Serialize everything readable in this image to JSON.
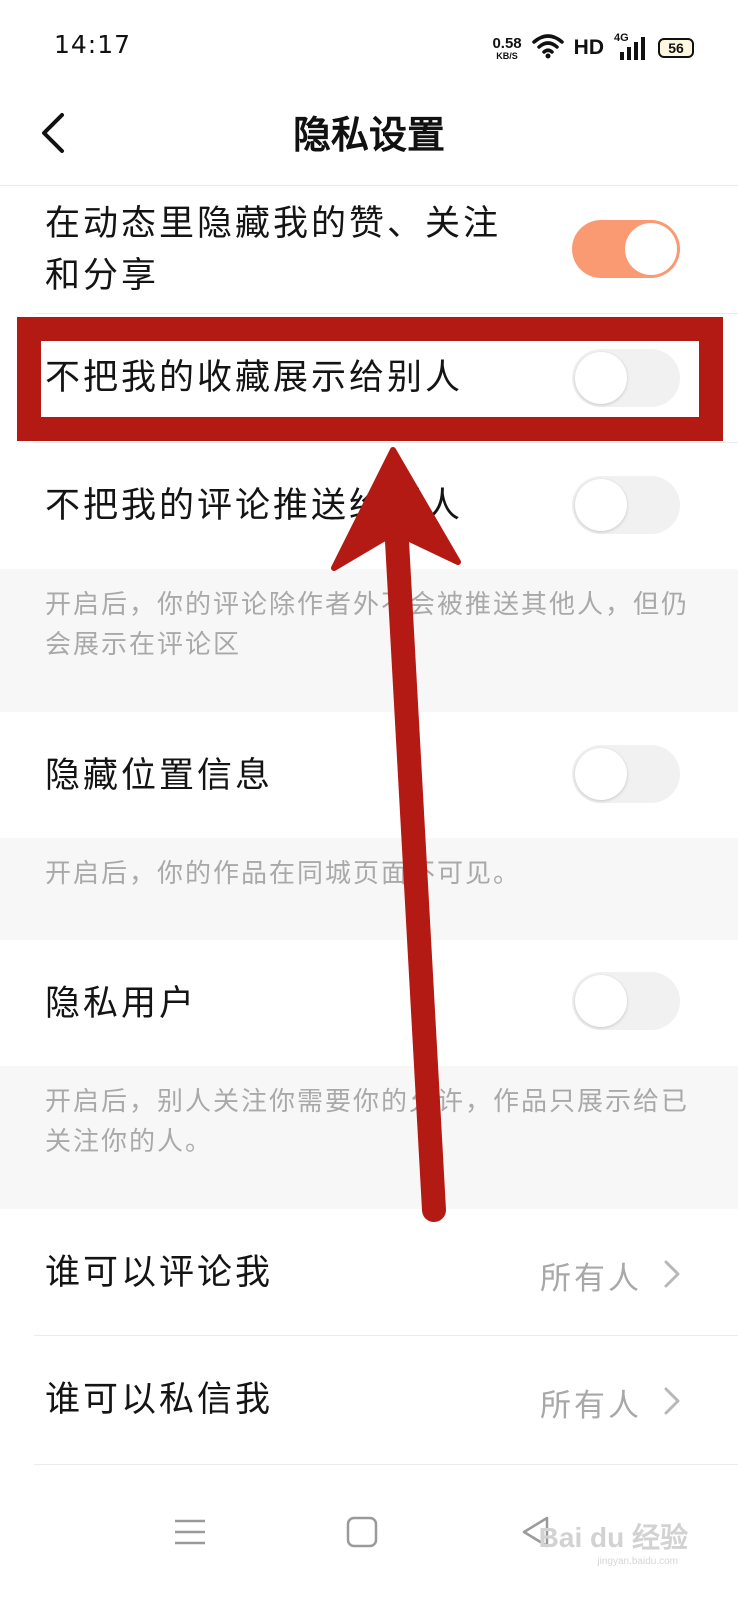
{
  "status_bar": {
    "time": "14:17",
    "net_speed_value": "0.58",
    "net_speed_unit": "KB/S",
    "wifi_icon": "wifi-icon",
    "hd_label": "HD",
    "signal_label": "4G",
    "battery": "56"
  },
  "header": {
    "back_icon": "chevron-left-icon",
    "title": "隐私设置"
  },
  "settings": {
    "hide_likes": {
      "label_line1": "在动态里隐藏我的赞、关注",
      "label_line2": "和分享",
      "enabled": true
    },
    "hide_favorites": {
      "label": "不把我的收藏展示给别人",
      "enabled": false
    },
    "no_push_comments": {
      "label": "不把我的评论推送给别人",
      "enabled": false,
      "description": "开启后，你的评论除作者外不会被推送其他人，但仍会展示在评论区"
    },
    "hide_location": {
      "label": "隐藏位置信息",
      "enabled": false,
      "description": "开启后，你的作品在同城页面不可见。"
    },
    "private_user": {
      "label": "隐私用户",
      "enabled": false,
      "description": "开启后，别人关注你需要你的允许，作品只展示给已关注你的人。"
    },
    "who_can_comment": {
      "label": "谁可以评论我",
      "value": "所有人"
    },
    "who_can_message": {
      "label": "谁可以私信我",
      "value": "所有人"
    }
  },
  "nav_bar": {
    "menu_icon": "menu-icon",
    "home_icon": "home-square-icon",
    "back_icon": "back-triangle-icon"
  },
  "watermark": {
    "text": "Bai du 经验",
    "sub": "jingyan.baidu.com"
  },
  "colors": {
    "toggle_on": "#fa9a72",
    "toggle_off": "#f1f1f1",
    "annotation_red": "#b41a14",
    "desc_bg": "#f7f7f7"
  }
}
